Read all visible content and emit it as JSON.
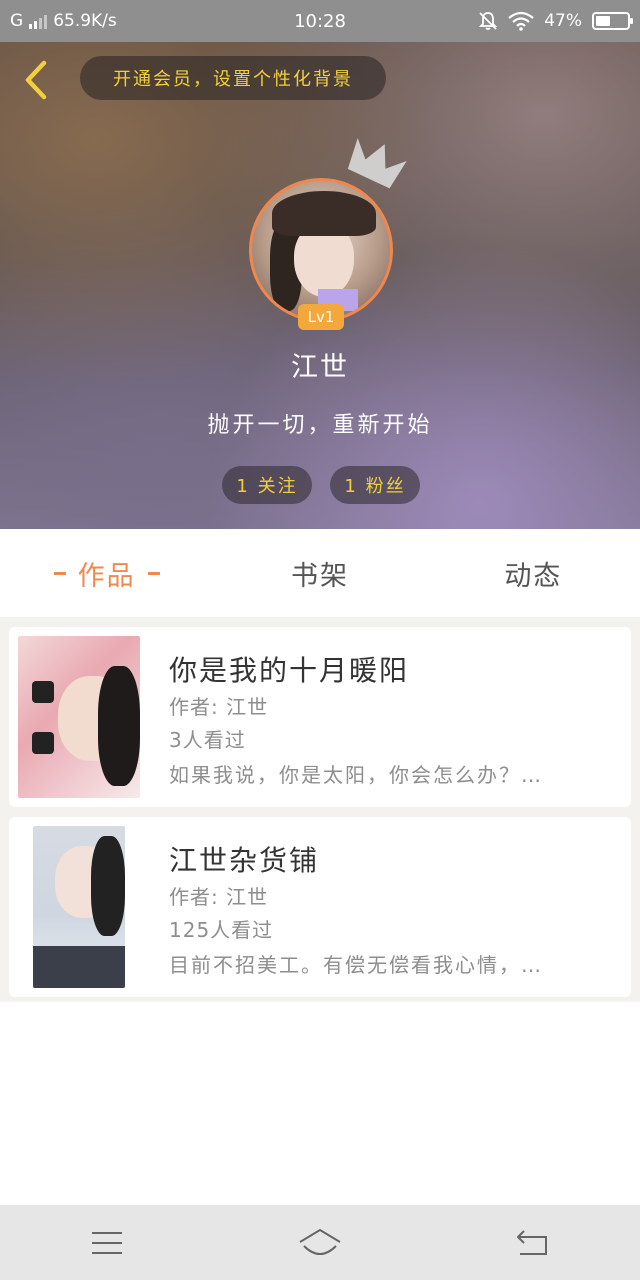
{
  "status_bar": {
    "network": "G",
    "speed": "65.9K/s",
    "time": "10:28",
    "battery_text": "47%",
    "battery_level": 0.47
  },
  "header": {
    "back_icon": "chevron-left-icon",
    "vip_text": "开通会员，设置个性化背景",
    "level": "Lv1",
    "username": "江世",
    "signature": "抛开一切，重新开始",
    "following": "1 关注",
    "followers": "1 粉丝"
  },
  "tabs": [
    {
      "label": "作品",
      "active": true
    },
    {
      "label": "书架",
      "active": false
    },
    {
      "label": "动态",
      "active": false
    }
  ],
  "works": [
    {
      "title": "你是我的十月暖阳",
      "author": "作者: 江世",
      "views": "3人看过",
      "description": "如果我说，你是太阳，你会怎么办？…"
    },
    {
      "title": "江世杂货铺",
      "author": "作者: 江世",
      "views": "125人看过",
      "description": "目前不招美工。有偿无偿看我心情，…"
    }
  ],
  "navbar": {
    "menu_icon": "menu-icon",
    "home_icon": "home-icon",
    "back_icon": "back-icon"
  },
  "colors": {
    "accent": "#ee8a4e",
    "gold": "#f2cf3c",
    "level_badge": "#f2a83a"
  }
}
